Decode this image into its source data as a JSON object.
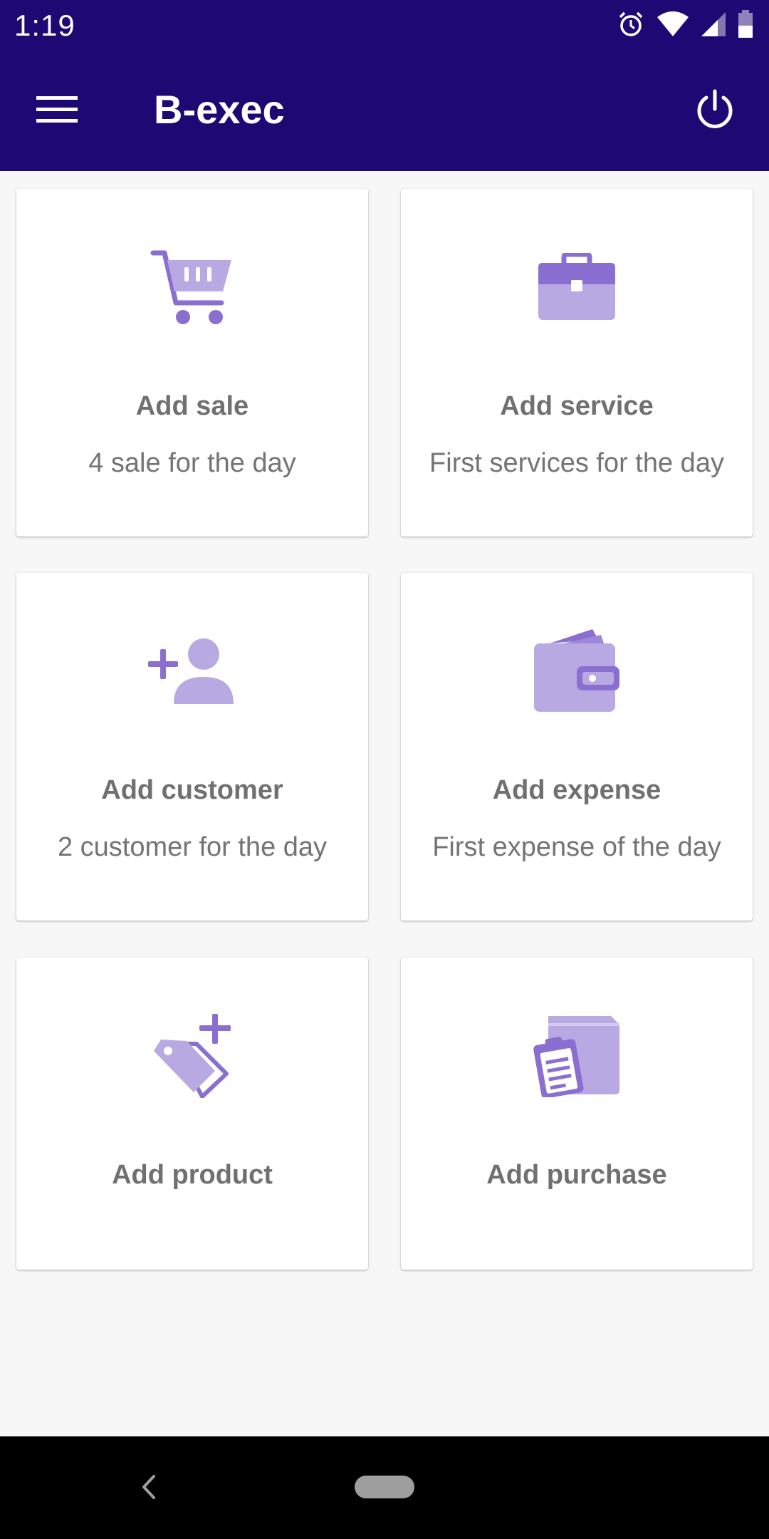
{
  "status_bar": {
    "time": "1:19",
    "icons": [
      "alarm-icon",
      "wifi-icon",
      "signal-icon",
      "battery-icon"
    ]
  },
  "app_bar": {
    "title": "B-exec",
    "menu_icon": "menu-icon",
    "power_icon": "power-icon"
  },
  "colors": {
    "primary": "#1e0874",
    "icon_dark": "#8a6fd1",
    "icon_light": "#b9a9e3"
  },
  "cards": [
    {
      "icon": "cart-icon",
      "title": "Add sale",
      "subtitle": "4 sale for the day"
    },
    {
      "icon": "briefcase-icon",
      "title": "Add service",
      "subtitle": "First services for the day"
    },
    {
      "icon": "add-customer-icon",
      "title": "Add customer",
      "subtitle": "2 customer for the day"
    },
    {
      "icon": "wallet-icon",
      "title": "Add expense",
      "subtitle": "First expense of the day"
    },
    {
      "icon": "add-tag-icon",
      "title": "Add product",
      "subtitle": ""
    },
    {
      "icon": "clipboard-box-icon",
      "title": "Add purchase",
      "subtitle": ""
    }
  ],
  "nav_bar": {
    "back_icon": "back-icon",
    "home_icon": "home-pill-icon"
  }
}
